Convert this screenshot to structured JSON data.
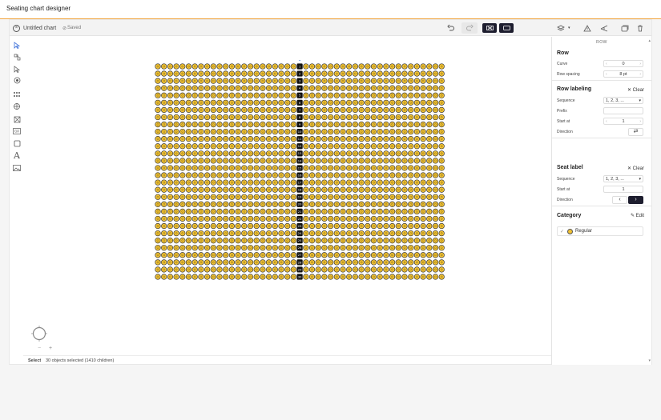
{
  "app_title": "Seating chart designer",
  "toolbar": {
    "close_icon": "close-circle-icon",
    "chart_name": "Untitled chart",
    "saved_status": "Saved",
    "undo_icon": "undo-icon",
    "redo_icon": "redo-icon",
    "view_mode_1_icon": "section-view-icon",
    "view_mode_2_icon": "rectangle-view-icon",
    "layers_icon": "layers-icon",
    "warning_icon": "warning-icon",
    "share_icon": "share-icon",
    "duplicate_icon": "duplicate-icon",
    "delete_icon": "trash-icon"
  },
  "tools": [
    "select-pointer-icon",
    "multi-select-icon",
    "node-select-icon",
    "focal-point-icon",
    "seat-rows-icon",
    "section-icon",
    "table-icon",
    "booth-icon",
    "shape-icon",
    "text-icon",
    "image-icon"
  ],
  "canvas": {
    "rows": 30,
    "seats_per_row": 47,
    "aisle_index": 23,
    "aisle_labels": [
      "1",
      "2",
      "3",
      "4",
      "5",
      "6",
      "7",
      "8",
      "9",
      "10",
      "11",
      "12",
      "13",
      "14",
      "15",
      "16",
      "17",
      "18",
      "19",
      "20",
      "21",
      "22",
      "23",
      "24",
      "25",
      "26",
      "27",
      "28",
      "29",
      "30"
    ]
  },
  "status": {
    "mode": "Select",
    "info": "30 objects selected (1410 children)"
  },
  "zoom": {
    "minus": "−",
    "plus": "+"
  },
  "sidebar": {
    "header": "ROW",
    "row": {
      "title": "Row",
      "curve_label": "Curve",
      "curve_value": "0",
      "spacing_label": "Row spacing",
      "spacing_value": "8 pt"
    },
    "row_labeling": {
      "title": "Row labeling",
      "clear": "Clear",
      "sequence_label": "Sequence",
      "sequence_value": "1, 2, 3, ...",
      "prefix_label": "Prefix",
      "prefix_value": "",
      "start_label": "Start at",
      "start_value": "1",
      "direction_label": "Direction"
    },
    "seat_label": {
      "title": "Seat label",
      "clear": "Clear",
      "sequence_label": "Sequence",
      "sequence_value": "1, 2, 3, ...",
      "start_label": "Start at",
      "start_value": "1",
      "direction_label": "Direction"
    },
    "category": {
      "title": "Category",
      "edit": "Edit",
      "item": "Regular",
      "color": "#f2c232"
    }
  }
}
